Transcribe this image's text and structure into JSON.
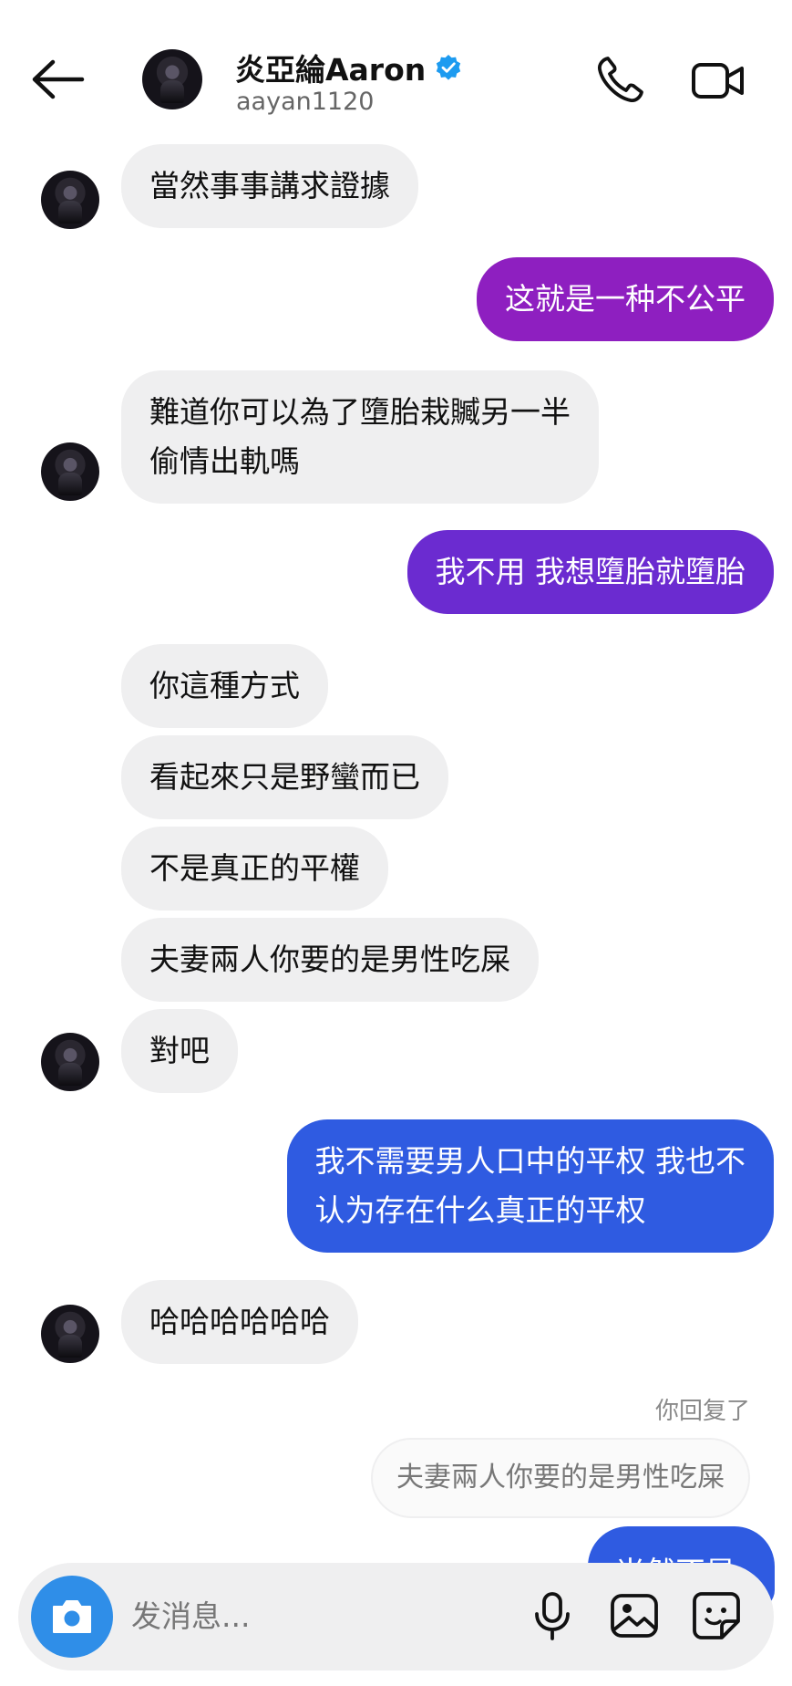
{
  "header": {
    "name": "炎亞綸Aaron",
    "handle": "aayan1120"
  },
  "messages": [
    {
      "text": "當然事事講求證據"
    },
    {
      "text": "这就是一种不公平"
    },
    {
      "text": "難道你可以為了墮胎栽贓另一半\n偷情出軌嗎"
    },
    {
      "text": "我不用 我想墮胎就墮胎"
    },
    {
      "text": "你這種方式"
    },
    {
      "text": "看起來只是野蠻而已"
    },
    {
      "text": "不是真正的平權"
    },
    {
      "text": "夫妻兩人你要的是男性吃屎"
    },
    {
      "text": "對吧"
    },
    {
      "text": "我不需要男人口中的平权 我也不\n认为存在什么真正的平权"
    },
    {
      "text": "哈哈哈哈哈哈"
    }
  ],
  "reply": {
    "label": "你回复了",
    "quoted": "夫妻兩人你要的是男性吃屎",
    "partial_text": "当然不是"
  },
  "composer": {
    "placeholder": "发消息..."
  },
  "colors": {
    "incoming_bubble": "#efeff0",
    "outgoing_purple": "#8e1fc0",
    "outgoing_violet": "#6b2bd0",
    "outgoing_blue": "#2f5be1",
    "verified_badge": "#1d9bf0",
    "camera_button": "#2f8ee8"
  }
}
